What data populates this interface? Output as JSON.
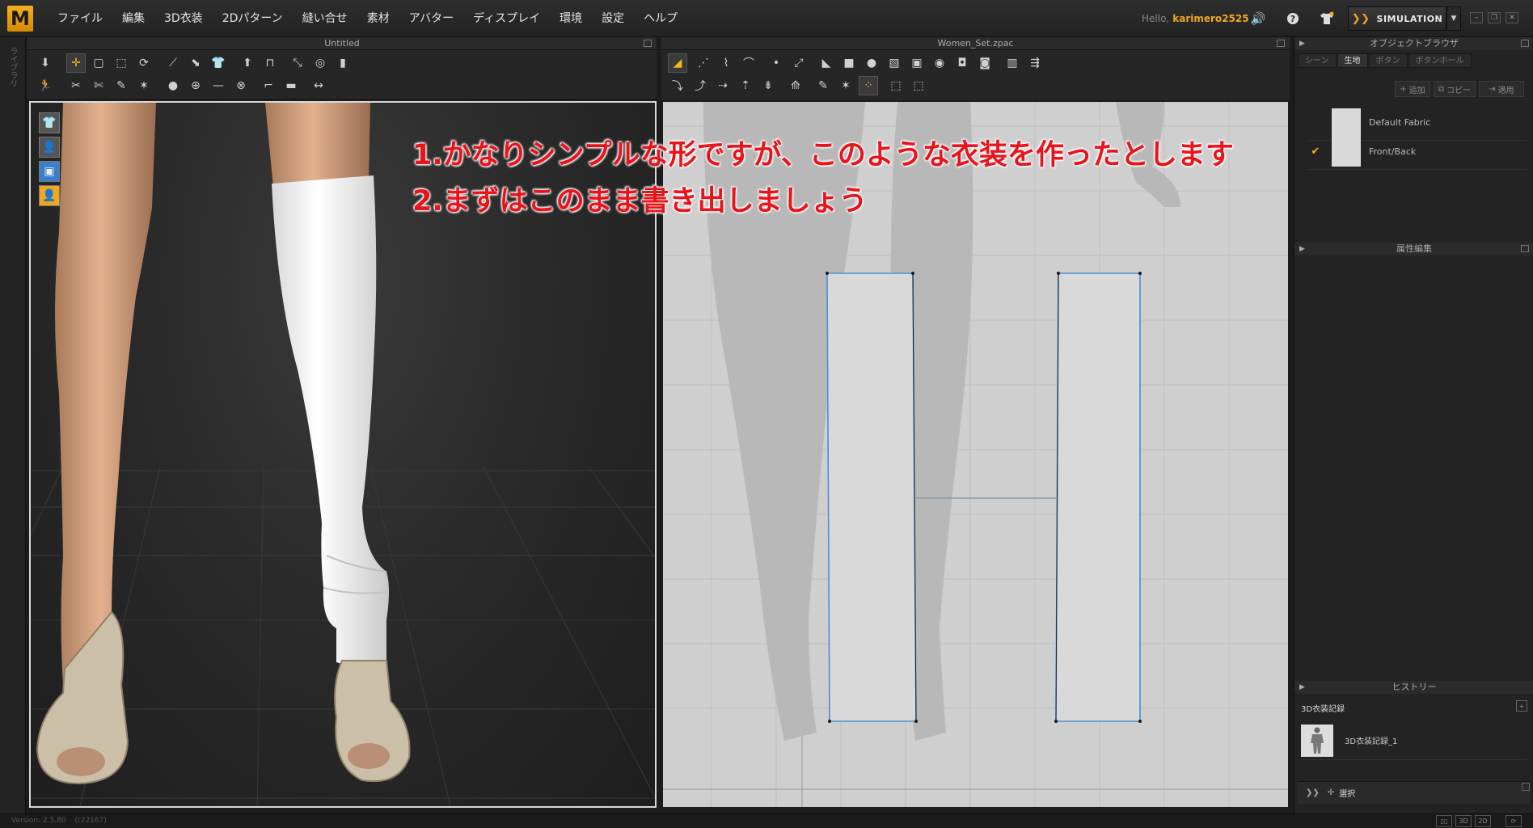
{
  "app": {
    "logo_letter": "M",
    "menus": [
      "ファイル",
      "編集",
      "3D衣装",
      "2Dパターン",
      "縫い合せ",
      "素材",
      "アバター",
      "ディスプレイ",
      "環境",
      "設定",
      "ヘルプ"
    ],
    "hello_label": "Hello,",
    "username": "karimero2525",
    "simulation_label": "SIMULATION",
    "accent_color": "#f2a81d"
  },
  "left_strip": {
    "label": "ライブラリ"
  },
  "viewport3d": {
    "title": "Untitled"
  },
  "viewport2d": {
    "title": "Women_Set.zpac"
  },
  "annotations": {
    "line1": "1.かなりシンプルな形ですが、このような衣装を作ったとします",
    "line2": "2.まずはこのまま書き出しましょう",
    "color": "#e8141c"
  },
  "object_browser": {
    "title": "オブジェクトブラウザ",
    "tabs": [
      "シーン",
      "生地",
      "ボタン",
      "ボタンホール"
    ],
    "active_tab": "生地",
    "buttons": {
      "add": "追加",
      "copy": "コピー",
      "apply": "適用"
    },
    "fabrics": [
      {
        "name": "Default Fabric",
        "checked": false
      },
      {
        "name": "Front/Back",
        "checked": true
      }
    ]
  },
  "property_editor": {
    "title": "属性編集"
  },
  "history": {
    "title": "ヒストリー",
    "section": "3D衣装記録",
    "items": [
      {
        "name": "3D衣装記録_1"
      }
    ]
  },
  "selection": {
    "label": "選択"
  },
  "status": {
    "version": "Version: 2.5.80",
    "build": "(r22167)",
    "view_modes": [
      "3D",
      "2D"
    ]
  }
}
